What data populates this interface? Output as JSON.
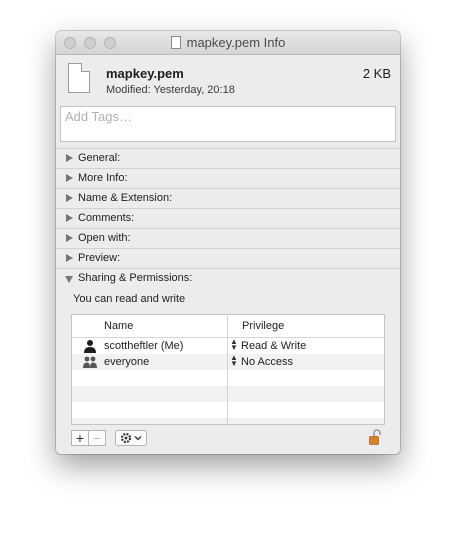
{
  "window": {
    "title": "mapkey.pem Info"
  },
  "file": {
    "name": "mapkey.pem",
    "size": "2 KB",
    "modified": "Modified: Yesterday, 20:18",
    "icon": "document-icon"
  },
  "tags": {
    "placeholder": "Add Tags…",
    "value": ""
  },
  "sections": [
    {
      "label": "General:",
      "expanded": false
    },
    {
      "label": "More Info:",
      "expanded": false
    },
    {
      "label": "Name & Extension:",
      "expanded": false
    },
    {
      "label": "Comments:",
      "expanded": false
    },
    {
      "label": "Open with:",
      "expanded": false
    },
    {
      "label": "Preview:",
      "expanded": false
    },
    {
      "label": "Sharing & Permissions:",
      "expanded": true
    }
  ],
  "permissions": {
    "summary": "You can read and write",
    "columns": {
      "name": "Name",
      "privilege": "Privilege"
    },
    "rows": [
      {
        "name": "scottheftler (Me)",
        "privilege": "Read & Write",
        "icon": "single-user-icon"
      },
      {
        "name": "everyone",
        "privilege": "No Access",
        "icon": "group-users-icon"
      }
    ]
  },
  "toolbar": {
    "add_label": "+",
    "remove_label": "−",
    "action_icon": "gear-icon",
    "lock_icon": "lock-unlocked-icon"
  },
  "colors": {
    "window_bg": "#ececec",
    "lock_accent": "#d9822b"
  }
}
